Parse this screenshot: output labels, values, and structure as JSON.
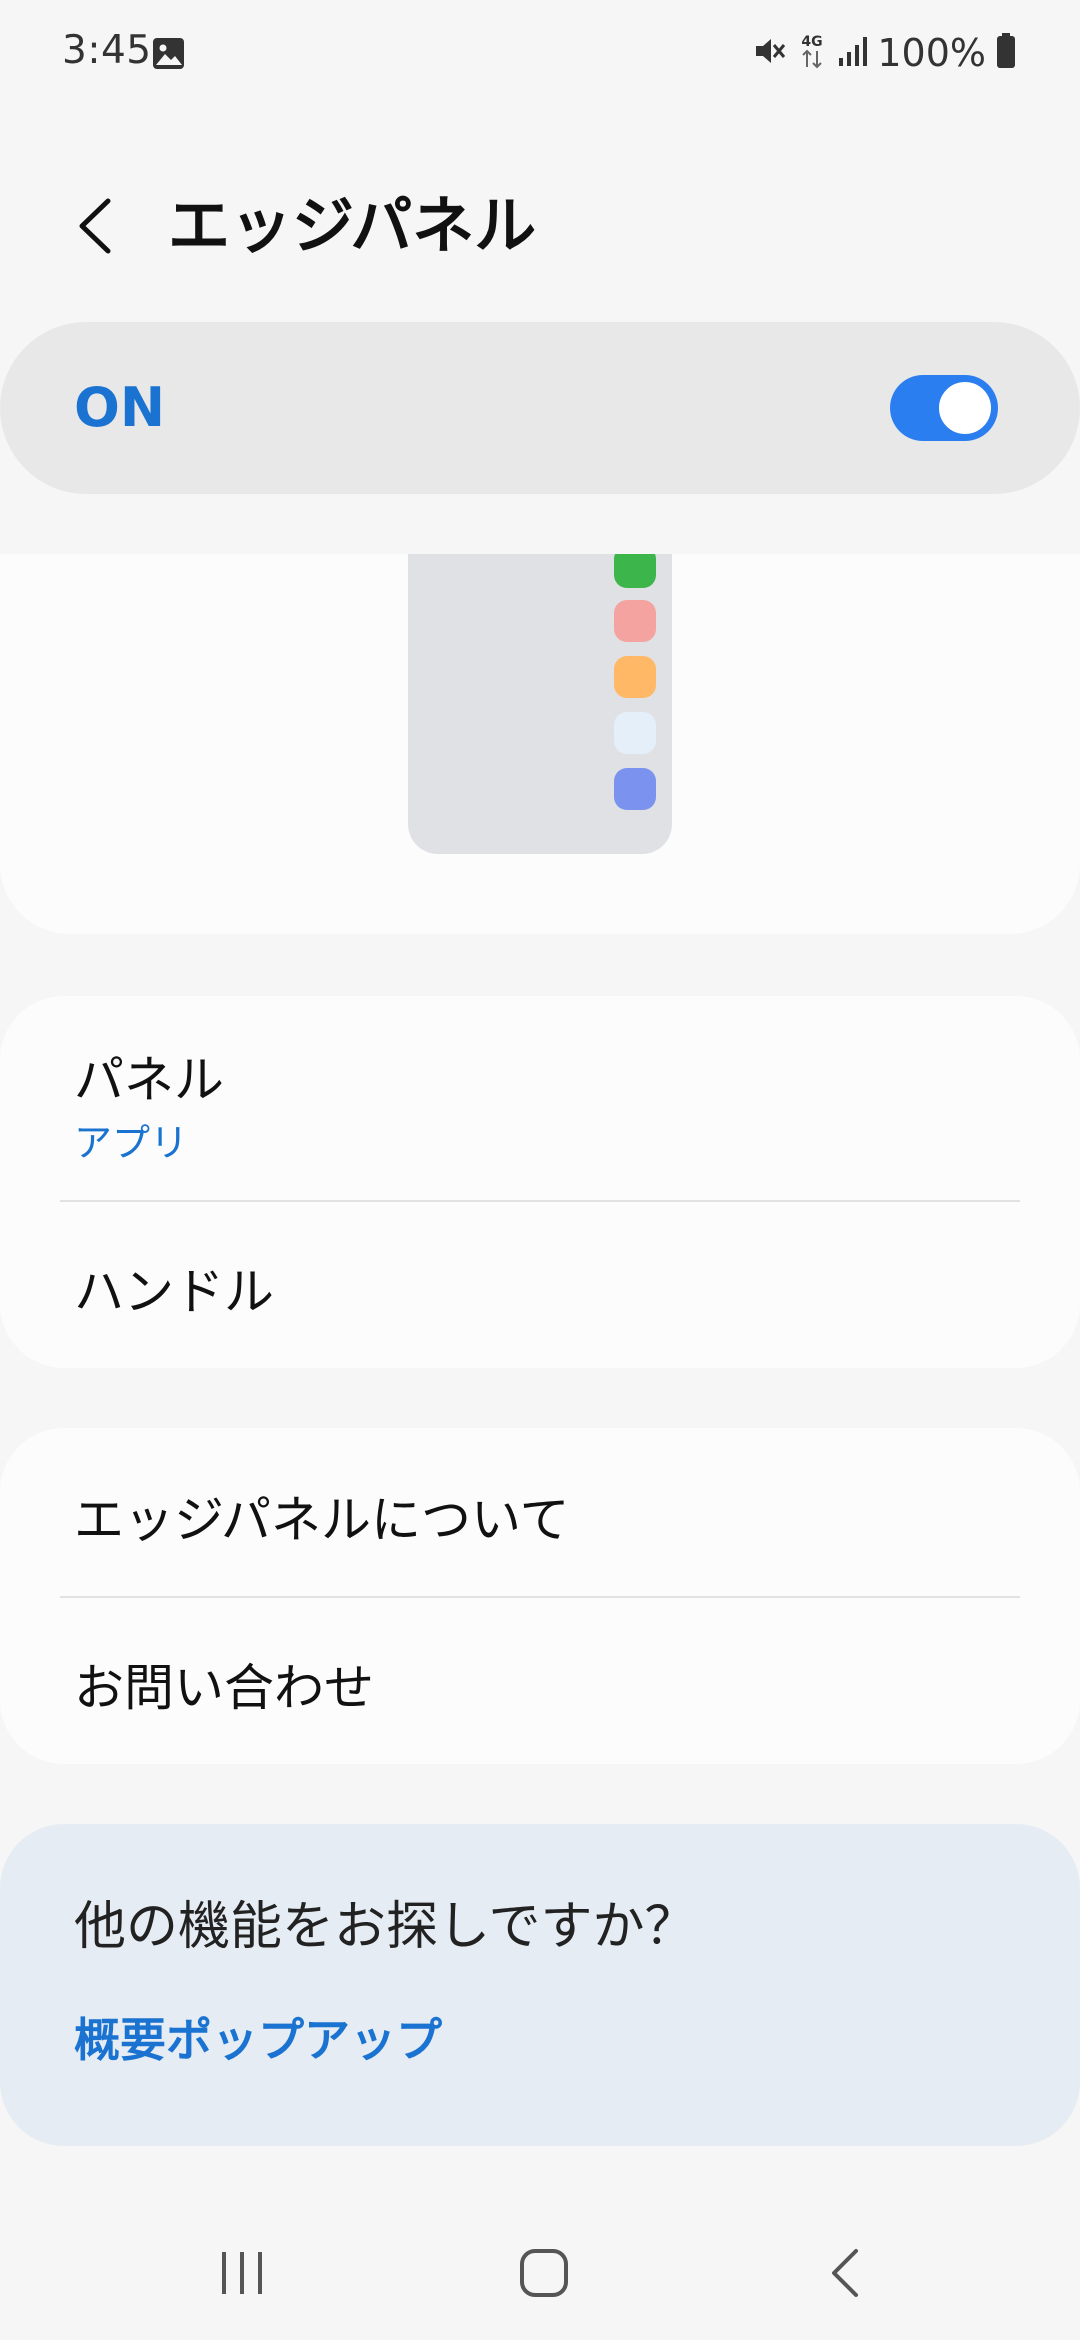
{
  "status_bar": {
    "time": "3:45",
    "battery_percent": "100%",
    "icons": [
      "gallery-icon",
      "mute-icon",
      "4g-icon",
      "signal-icon",
      "battery-icon"
    ]
  },
  "header": {
    "title": "エッジパネル",
    "back_icon": "chevron-left-icon"
  },
  "master_switch": {
    "label": "ON",
    "state": true,
    "accent": "#2a7ef0"
  },
  "preview": {
    "app_colors": [
      "#3cb54a",
      "#f4a3a1",
      "#ffb866",
      "#e4effa",
      "#7b93ef"
    ]
  },
  "settings_group_1": {
    "items": [
      {
        "title": "パネル",
        "subtitle": "アプリ"
      },
      {
        "title": "ハンドル"
      }
    ]
  },
  "settings_group_2": {
    "items": [
      {
        "title": "エッジパネルについて"
      },
      {
        "title": "お問い合わせ"
      }
    ]
  },
  "suggestion": {
    "question": "他の機能をお探しですか？",
    "link": "概要ポップアップ"
  },
  "nav_bar": {
    "icons": [
      "recents-icon",
      "home-icon",
      "back-icon"
    ]
  },
  "colors": {
    "accent": "#1a73d1",
    "background": "#f6f6f6",
    "card": "#fcfcfc",
    "suggestion_bg": "#e6ecf3"
  }
}
